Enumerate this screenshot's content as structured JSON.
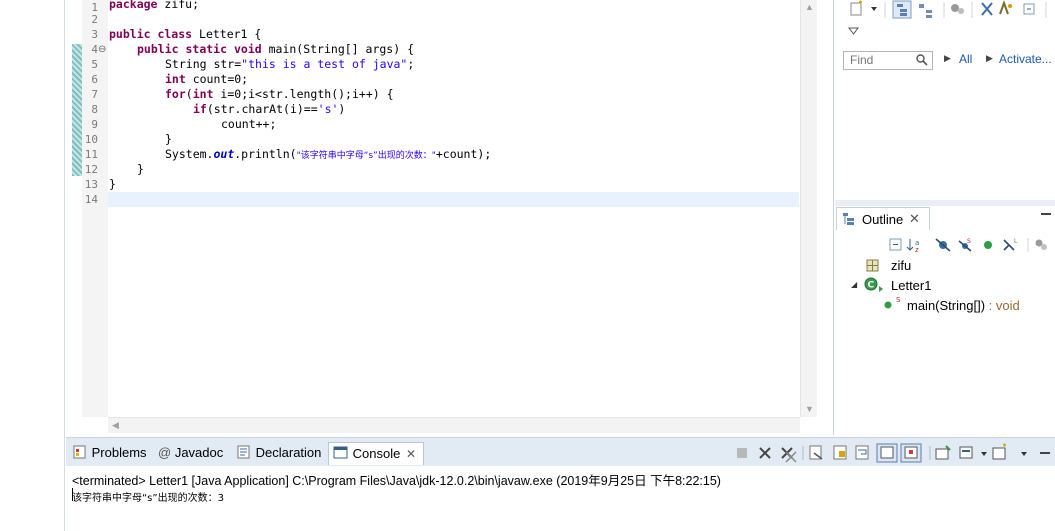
{
  "editor": {
    "line_numbers": [
      "1",
      "2",
      "3",
      "4",
      "5",
      "6",
      "7",
      "8",
      "9",
      "10",
      "11",
      "12",
      "13",
      "14"
    ],
    "fold_marker": "⊖",
    "code": {
      "l1_kw": "package",
      "l1_rest": " zifu;",
      "l3_kw": "public class",
      "l3_rest": " Letter1 {",
      "l4_kw1": "public",
      "l4_kw2": "static",
      "l4_kw3": "void",
      "l4_rest": " main(String[] args) {",
      "l5_pre": "String str=",
      "l5_str": "\"this is a test of java\"",
      "l5_post": ";",
      "l6_kw": "int",
      "l6_rest": " count=0;",
      "l7_kw1": "for",
      "l7_mid1": "(",
      "l7_kw2": "int",
      "l7_rest": " i=0;i<str.length();i++) {",
      "l8_kw": "if",
      "l8_pre": "(str.charAt(i)==",
      "l8_str": "'s'",
      "l8_post": ")",
      "l9": "count++;",
      "l10": "}",
      "l11_pre": "System.",
      "l11_fld": "out",
      "l11_mid": ".println(",
      "l11_str": "\"该字符串中字母“s”出现的次数：\"",
      "l11_post": "+count);",
      "l12": "}",
      "l13": "}"
    }
  },
  "right_panel": {
    "find_placeholder": "Find",
    "all_label": "All",
    "activate_label": "Activate..."
  },
  "outline": {
    "tab_label": "Outline",
    "tree": {
      "package": "zifu",
      "class": "Letter1",
      "method_name": "main(String[])",
      "method_type": " : void"
    }
  },
  "bottom": {
    "tabs": {
      "problems": "Problems",
      "javadoc": "Javadoc",
      "declaration": "Declaration",
      "console": "Console"
    },
    "console_status": "<terminated> Letter1 [Java Application] C:\\Program Files\\Java\\jdk-12.0.2\\bin\\javaw.exe (2019年9月25日 下午8:22:15)",
    "console_output": "该字符串中字母“s”出现的次数：3"
  },
  "colors": {
    "keyword": "#7f0055",
    "string": "#2a00ff",
    "field": "#0000c0",
    "link": "#1b58b8",
    "current_line": "#e8f2fe"
  }
}
